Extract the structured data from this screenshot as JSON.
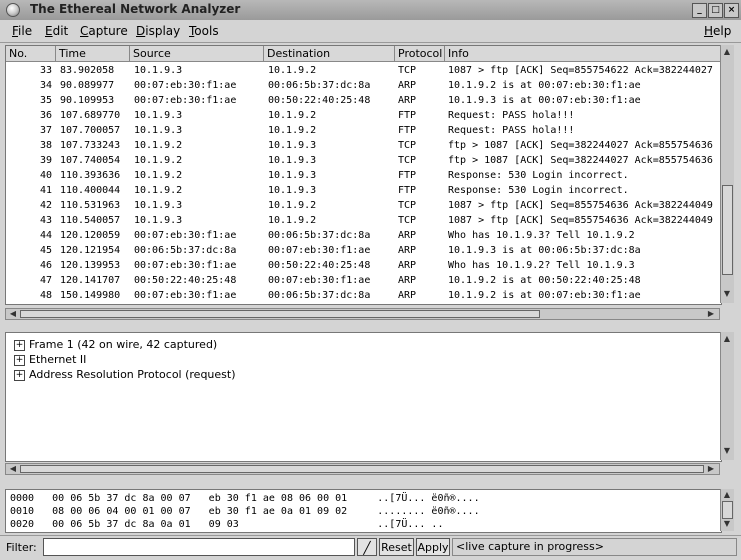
{
  "window": {
    "title": "The Ethereal Network Analyzer"
  },
  "menu": {
    "file": "File",
    "edit": "Edit",
    "capture": "Capture",
    "display": "Display",
    "tools": "Tools",
    "help": "Help"
  },
  "columns": [
    "No.",
    "Time",
    "Source",
    "Destination",
    "Protocol",
    "Info"
  ],
  "packets": [
    [
      "33",
      "83.902058",
      "10.1.9.3",
      "10.1.9.2",
      "TCP",
      "1087 > ftp [ACK] Seq=855754622 Ack=382244027"
    ],
    [
      "34",
      "90.089977",
      "00:07:eb:30:f1:ae",
      "00:06:5b:37:dc:8a",
      "ARP",
      "10.1.9.2 is at 00:07:eb:30:f1:ae"
    ],
    [
      "35",
      "90.109953",
      "00:07:eb:30:f1:ae",
      "00:50:22:40:25:48",
      "ARP",
      "10.1.9.3 is at 00:07:eb:30:f1:ae"
    ],
    [
      "36",
      "107.689770",
      "10.1.9.3",
      "10.1.9.2",
      "FTP",
      "Request: PASS hola!!!"
    ],
    [
      "37",
      "107.700057",
      "10.1.9.3",
      "10.1.9.2",
      "FTP",
      "Request: PASS hola!!!"
    ],
    [
      "38",
      "107.733243",
      "10.1.9.2",
      "10.1.9.3",
      "TCP",
      "ftp > 1087 [ACK] Seq=382244027 Ack=855754636"
    ],
    [
      "39",
      "107.740054",
      "10.1.9.2",
      "10.1.9.3",
      "TCP",
      "ftp > 1087 [ACK] Seq=382244027 Ack=855754636"
    ],
    [
      "40",
      "110.393636",
      "10.1.9.2",
      "10.1.9.3",
      "FTP",
      "Response: 530 Login incorrect."
    ],
    [
      "41",
      "110.400044",
      "10.1.9.2",
      "10.1.9.3",
      "FTP",
      "Response: 530 Login incorrect."
    ],
    [
      "42",
      "110.531963",
      "10.1.9.3",
      "10.1.9.2",
      "TCP",
      "1087 > ftp [ACK] Seq=855754636 Ack=382244049"
    ],
    [
      "43",
      "110.540057",
      "10.1.9.3",
      "10.1.9.2",
      "TCP",
      "1087 > ftp [ACK] Seq=855754636 Ack=382244049"
    ],
    [
      "44",
      "120.120059",
      "00:07:eb:30:f1:ae",
      "00:06:5b:37:dc:8a",
      "ARP",
      "Who has 10.1.9.3?  Tell 10.1.9.2"
    ],
    [
      "45",
      "120.121954",
      "00:06:5b:37:dc:8a",
      "00:07:eb:30:f1:ae",
      "ARP",
      "10.1.9.3 is at 00:06:5b:37:dc:8a"
    ],
    [
      "46",
      "120.139953",
      "00:07:eb:30:f1:ae",
      "00:50:22:40:25:48",
      "ARP",
      "Who has 10.1.9.2?  Tell 10.1.9.3"
    ],
    [
      "47",
      "120.141707",
      "00:50:22:40:25:48",
      "00:07:eb:30:f1:ae",
      "ARP",
      "10.1.9.2 is at 00:50:22:40:25:48"
    ],
    [
      "48",
      "150.149980",
      "00:07:eb:30:f1:ae",
      "00:06:5b:37:dc:8a",
      "ARP",
      "10.1.9.2 is at 00:07:eb:30:f1:ae"
    ]
  ],
  "tree": [
    "Frame 1 (42 on wire, 42 captured)",
    "Ethernet II",
    "Address Resolution Protocol (request)"
  ],
  "hex": [
    "0000   00 06 5b 37 dc 8a 00 07   eb 30 f1 ae 08 06 00 01     ..[7Ü... ë0ñ®....",
    "0010   08 00 06 04 00 01 00 07   eb 30 f1 ae 0a 01 09 02     ........ ë0ñ®....",
    "0020   00 06 5b 37 dc 8a 0a 01   09 03                       ..[7Ü... .."
  ],
  "filter": {
    "label": "Filter:",
    "value": "",
    "reset": "Reset",
    "apply": "Apply",
    "status": "<live capture in progress>"
  }
}
